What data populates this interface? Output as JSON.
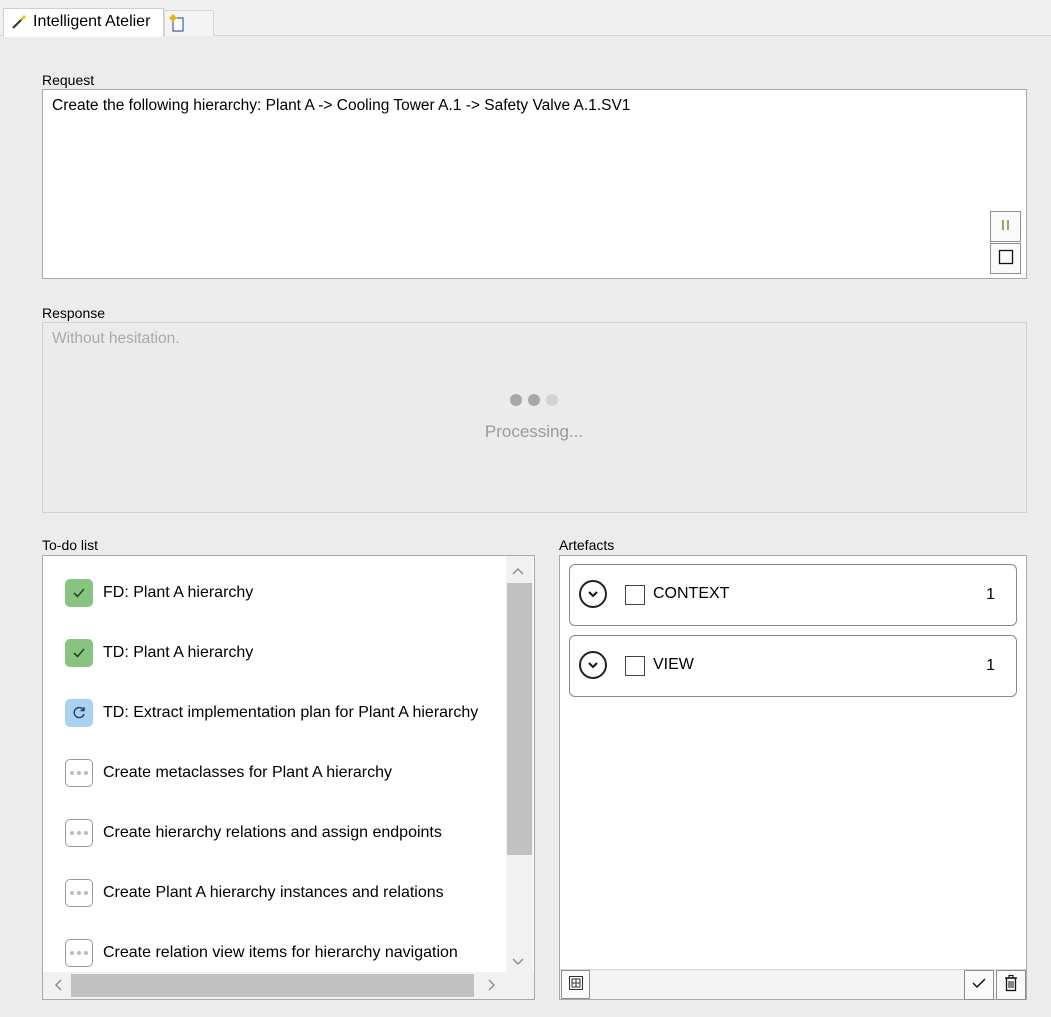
{
  "tabs": [
    {
      "label": "Intelligent Atelier",
      "icon": "magic-wand-icon"
    },
    {
      "label": "",
      "icon": "new-document-icon"
    }
  ],
  "request": {
    "label": "Request",
    "text": "Create the following hierarchy: Plant A -> Cooling Tower A.1 -> Safety Valve A.1.SV1",
    "pause_icon": "pause-icon",
    "stop_icon": "stop-icon"
  },
  "response": {
    "label": "Response",
    "placeholder": "Without hesitation.",
    "processing_text": "Processing..."
  },
  "todo": {
    "label": "To-do list",
    "items": [
      {
        "label": "FD: Plant A hierarchy",
        "status": "done"
      },
      {
        "label": "TD: Plant A hierarchy",
        "status": "done"
      },
      {
        "label": "TD: Extract implementation plan for Plant A hierarchy",
        "status": "in-progress"
      },
      {
        "label": "Create metaclasses for Plant A hierarchy",
        "status": "pending"
      },
      {
        "label": "Create hierarchy relations and assign endpoints",
        "status": "pending"
      },
      {
        "label": "Create Plant A hierarchy instances and relations",
        "status": "pending"
      },
      {
        "label": "Create relation view items for hierarchy navigation",
        "status": "pending"
      }
    ]
  },
  "artefacts": {
    "label": "Artefacts",
    "groups": [
      {
        "name": "CONTEXT",
        "count": "1"
      },
      {
        "name": "VIEW",
        "count": "1"
      }
    ]
  },
  "colors": {
    "done": "#86c47f",
    "in_progress": "#a9d1f0",
    "pending_border": "#9a9a9a"
  }
}
